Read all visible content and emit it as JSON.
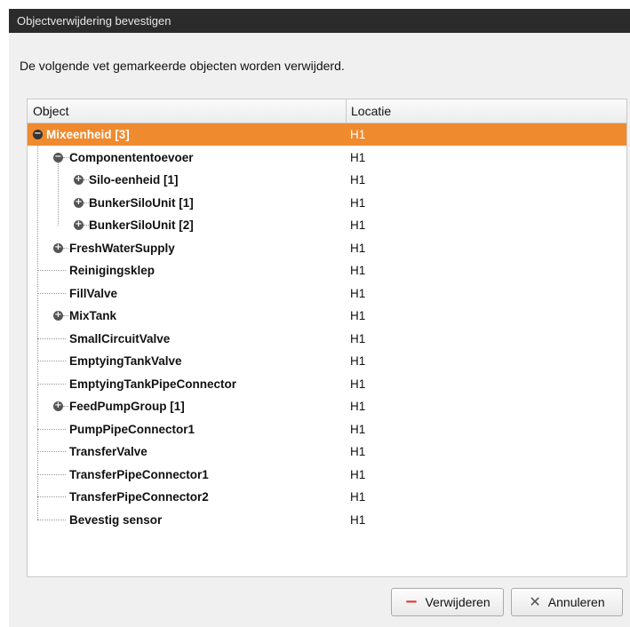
{
  "dialog": {
    "title": "Objectverwijdering bevestigen",
    "message": "De volgende vet gemarkeerde objecten worden verwijderd."
  },
  "tree": {
    "columns": {
      "object": "Object",
      "location": "Locatie"
    },
    "rows": [
      {
        "name": "Mixeenheid [3]",
        "location": "H1",
        "level": 0,
        "expander": "collapse",
        "selected": true
      },
      {
        "name": "Componententoevoer",
        "location": "H1",
        "level": 1,
        "expander": "collapse"
      },
      {
        "name": "Silo-eenheid [1]",
        "location": "H1",
        "level": 2,
        "expander": "expand"
      },
      {
        "name": "BunkerSiloUnit [1]",
        "location": "H1",
        "level": 2,
        "expander": "expand"
      },
      {
        "name": "BunkerSiloUnit [2]",
        "location": "H1",
        "level": 2,
        "expander": "expand"
      },
      {
        "name": "FreshWaterSupply",
        "location": "H1",
        "level": 1,
        "expander": "expand"
      },
      {
        "name": "Reinigingsklep",
        "location": "H1",
        "level": 1,
        "expander": "none"
      },
      {
        "name": "FillValve",
        "location": "H1",
        "level": 1,
        "expander": "none"
      },
      {
        "name": "MixTank",
        "location": "H1",
        "level": 1,
        "expander": "expand"
      },
      {
        "name": "SmallCircuitValve",
        "location": "H1",
        "level": 1,
        "expander": "none"
      },
      {
        "name": "EmptyingTankValve",
        "location": "H1",
        "level": 1,
        "expander": "none"
      },
      {
        "name": "EmptyingTankPipeConnector",
        "location": "H1",
        "level": 1,
        "expander": "none"
      },
      {
        "name": "FeedPumpGroup [1]",
        "location": "H1",
        "level": 1,
        "expander": "expand"
      },
      {
        "name": "PumpPipeConnector1",
        "location": "H1",
        "level": 1,
        "expander": "none"
      },
      {
        "name": "TransferValve",
        "location": "H1",
        "level": 1,
        "expander": "none"
      },
      {
        "name": "TransferPipeConnector1",
        "location": "H1",
        "level": 1,
        "expander": "none"
      },
      {
        "name": "TransferPipeConnector2",
        "location": "H1",
        "level": 1,
        "expander": "none"
      },
      {
        "name": "Bevestig sensor",
        "location": "H1",
        "level": 1,
        "expander": "none"
      }
    ]
  },
  "buttons": {
    "delete": {
      "label": "Verwijderen",
      "icon": "minus-icon"
    },
    "cancel": {
      "label": "Annuleren",
      "icon": "close-icon"
    }
  },
  "colors": {
    "selection": "#f08a2e",
    "titlebar": "#2b2b2b"
  }
}
